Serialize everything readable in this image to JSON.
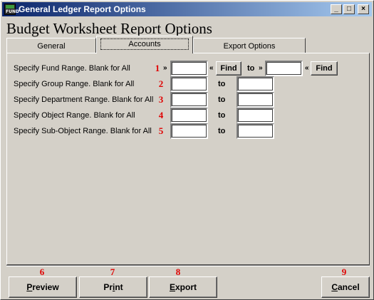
{
  "window": {
    "title": "General Ledger Report Options",
    "icon_label": "FUND",
    "minimize": "_",
    "maximize": "□",
    "close": "×"
  },
  "heading": "Budget Worksheet Report Options",
  "tabs": [
    {
      "label": "General",
      "active": false
    },
    {
      "label": "Accounts",
      "active": true
    },
    {
      "label": "Export Options",
      "active": false
    }
  ],
  "rows": [
    {
      "label": "Specify Fund Range. Blank for All",
      "number": "1",
      "from_value": "",
      "to_value": "",
      "has_find": true
    },
    {
      "label": "Specify Group Range. Blank for All",
      "number": "2",
      "from_value": "",
      "to_value": "",
      "has_find": false
    },
    {
      "label": "Specify Department Range. Blank for All",
      "number": "3",
      "from_value": "",
      "to_value": "",
      "has_find": false
    },
    {
      "label": "Specify Object Range. Blank for All",
      "number": "4",
      "from_value": "",
      "to_value": "",
      "has_find": false
    },
    {
      "label": "Specify Sub-Object Range. Blank for All",
      "number": "5",
      "from_value": "",
      "to_value": "",
      "has_find": false
    }
  ],
  "find_label": "Find",
  "to_label": "to",
  "arrow_right": "»",
  "arrow_left": "«",
  "buttons": [
    {
      "number": "6",
      "label_first": "P",
      "label_rest": "review"
    },
    {
      "number": "7",
      "label_first": "",
      "label_pre": "Pr",
      "label_u": "i",
      "label_post": "nt"
    },
    {
      "number": "8",
      "label_first": "E",
      "label_rest": "xport"
    },
    {
      "number": "9",
      "label_first": "C",
      "label_rest": "ancel"
    }
  ],
  "colors": {
    "title_start": "#0a246a",
    "title_end": "#a6caf0",
    "face": "#d4d0c8",
    "marker": "#e00000"
  }
}
